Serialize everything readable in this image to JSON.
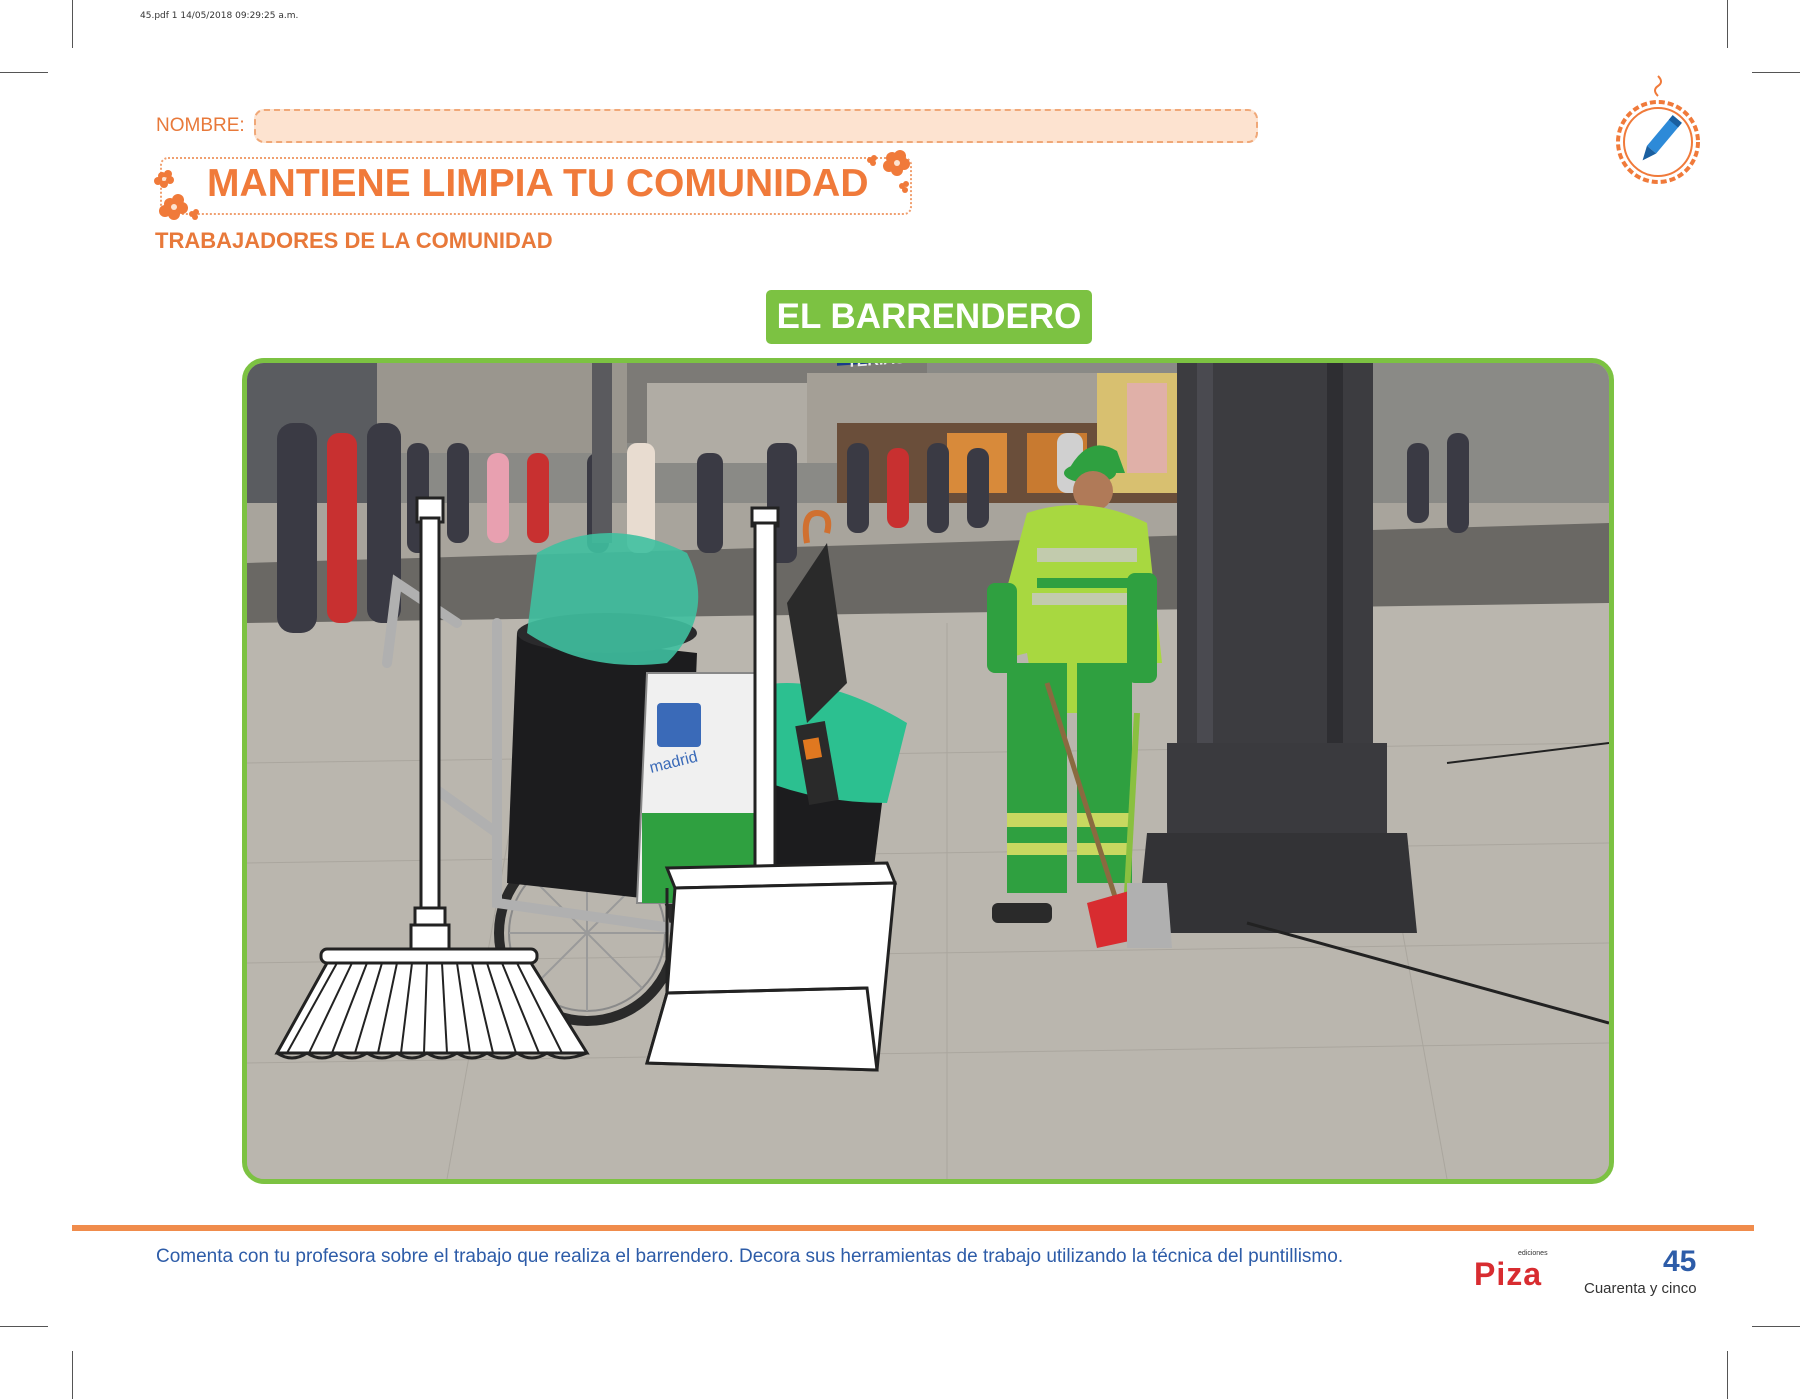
{
  "print_header": "45.pdf   1   14/05/2018   09:29:25 a.m.",
  "header": {
    "nombre_label": "NOMBRE:",
    "title": "MANTIENE LIMPIA TU COMUNIDAD",
    "subtitle": "TRABAJADORES DE LA COMUNIDAD"
  },
  "section_title": "EL BARRENDERO",
  "photo": {
    "shop_sign": "TERIAS NUEVOS GUERRILLEROS",
    "bin_label": "madrid"
  },
  "footer": {
    "instruction": "Comenta con tu profesora sobre el trabajo que realiza el barrendero. Decora sus herramientas de trabajo utilizando la técnica del puntillismo.",
    "logo_small": "ediciones",
    "logo_text": "Piza",
    "page_number": "45",
    "page_words": "Cuarenta y cinco"
  },
  "colors": {
    "orange": "#f07a3a",
    "green": "#7cc242",
    "blue": "#2d5ca8",
    "peach": "#fde3d0"
  },
  "icons": [
    "pencil-icon",
    "flower-icon",
    "broom-icon",
    "dustpan-icon"
  ]
}
